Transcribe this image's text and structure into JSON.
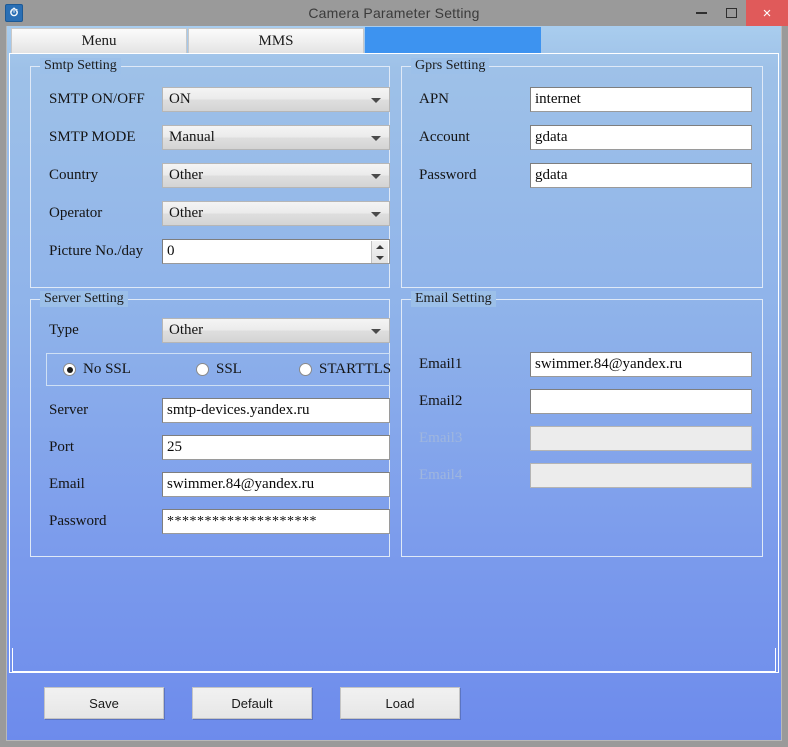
{
  "window": {
    "title": "Camera Parameter Setting",
    "icon": "app-logo-icon",
    "minimize_label": "",
    "maximize_label": "",
    "close_label": "×",
    "accent_color": "#3d93f0",
    "close_color": "#e05a5a",
    "bg_top_color": "#9ec1e8",
    "bg_bottom_color": "#6d8bec"
  },
  "tabs": [
    {
      "label": "Menu",
      "active": false
    },
    {
      "label": "MMS",
      "active": false
    },
    {
      "label": "",
      "active": true
    }
  ],
  "smtp_setting": {
    "title": "Smtp Setting",
    "fields": [
      {
        "label": "SMTP ON/OFF",
        "value": "ON",
        "type": "combo"
      },
      {
        "label": "SMTP MODE",
        "value": "Manual",
        "type": "combo"
      },
      {
        "label": "Country",
        "value": "Other",
        "type": "combo"
      },
      {
        "label": "Operator",
        "value": "Other",
        "type": "combo"
      },
      {
        "label": "Picture No./day",
        "value": "0",
        "type": "spinner"
      }
    ]
  },
  "gprs_setting": {
    "title": "Gprs Setting",
    "fields": [
      {
        "label": "APN",
        "value": "internet"
      },
      {
        "label": "Account",
        "value": "gdata"
      },
      {
        "label": "Password",
        "value": "gdata"
      }
    ]
  },
  "server_setting": {
    "title": "Server Setting",
    "type_label": "Type",
    "type_value": "Other",
    "ssl_options": [
      {
        "label": "No SSL",
        "checked": true
      },
      {
        "label": "SSL",
        "checked": false
      },
      {
        "label": "STARTTLS",
        "checked": false
      }
    ],
    "fields": [
      {
        "label": "Server",
        "value": "smtp-devices.yandex.ru"
      },
      {
        "label": "Port",
        "value": "25"
      },
      {
        "label": "Email",
        "value": "swimmer.84@yandex.ru"
      },
      {
        "label": "Password",
        "value": "********************"
      }
    ]
  },
  "email_setting": {
    "title": "Email Setting",
    "fields": [
      {
        "label": "Email1",
        "value": "swimmer.84@yandex.ru",
        "disabled": false
      },
      {
        "label": "Email2",
        "value": "",
        "disabled": false
      },
      {
        "label": "Email3",
        "value": "",
        "disabled": true
      },
      {
        "label": "Email4",
        "value": "",
        "disabled": true
      }
    ]
  },
  "footer": {
    "save_label": "Save",
    "default_label": "Default",
    "load_label": "Load"
  }
}
